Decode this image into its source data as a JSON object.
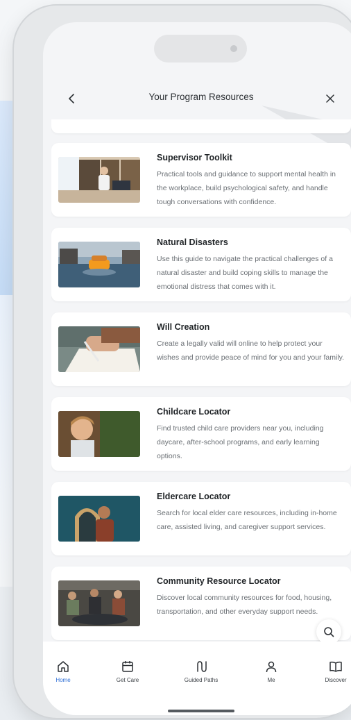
{
  "header": {
    "title": "Your Program Resources"
  },
  "resources": [
    {
      "title": "Supervisor Toolkit",
      "description": "Practical tools and guidance to support mental health in the workplace, build psychological safety, and handle tough conversations with confidence."
    },
    {
      "title": "Natural Disasters",
      "description": "Use this guide to navigate the practical challenges of a natural disaster and build coping skills to manage the emotional distress that comes with it."
    },
    {
      "title": "Will Creation",
      "description": "Create a legally valid will online to help protect your wishes and provide peace of mind for you and your family."
    },
    {
      "title": "Childcare Locator",
      "description": "Find trusted child care providers near you, including daycare, after-school programs, and early learning options."
    },
    {
      "title": "Eldercare Locator",
      "description": "Search for local elder care resources, including in-home care, assisted living, and caregiver support services."
    },
    {
      "title": "Community Resource Locator",
      "description": "Discover local community resources for food, housing, transportation, and other everyday support needs."
    }
  ],
  "tabbar": {
    "tabs": [
      {
        "label": "Home",
        "icon": "home-icon",
        "active": true
      },
      {
        "label": "Get Care",
        "icon": "calendar-icon",
        "active": false
      },
      {
        "label": "Guided Paths",
        "icon": "path-icon",
        "active": false
      },
      {
        "label": "Me",
        "icon": "person-icon",
        "active": false
      },
      {
        "label": "Discover",
        "icon": "book-icon",
        "active": false
      }
    ]
  },
  "colors": {
    "accent": "#2f6fd6",
    "card": "#ffffff",
    "screen": "#f4f5f7"
  }
}
